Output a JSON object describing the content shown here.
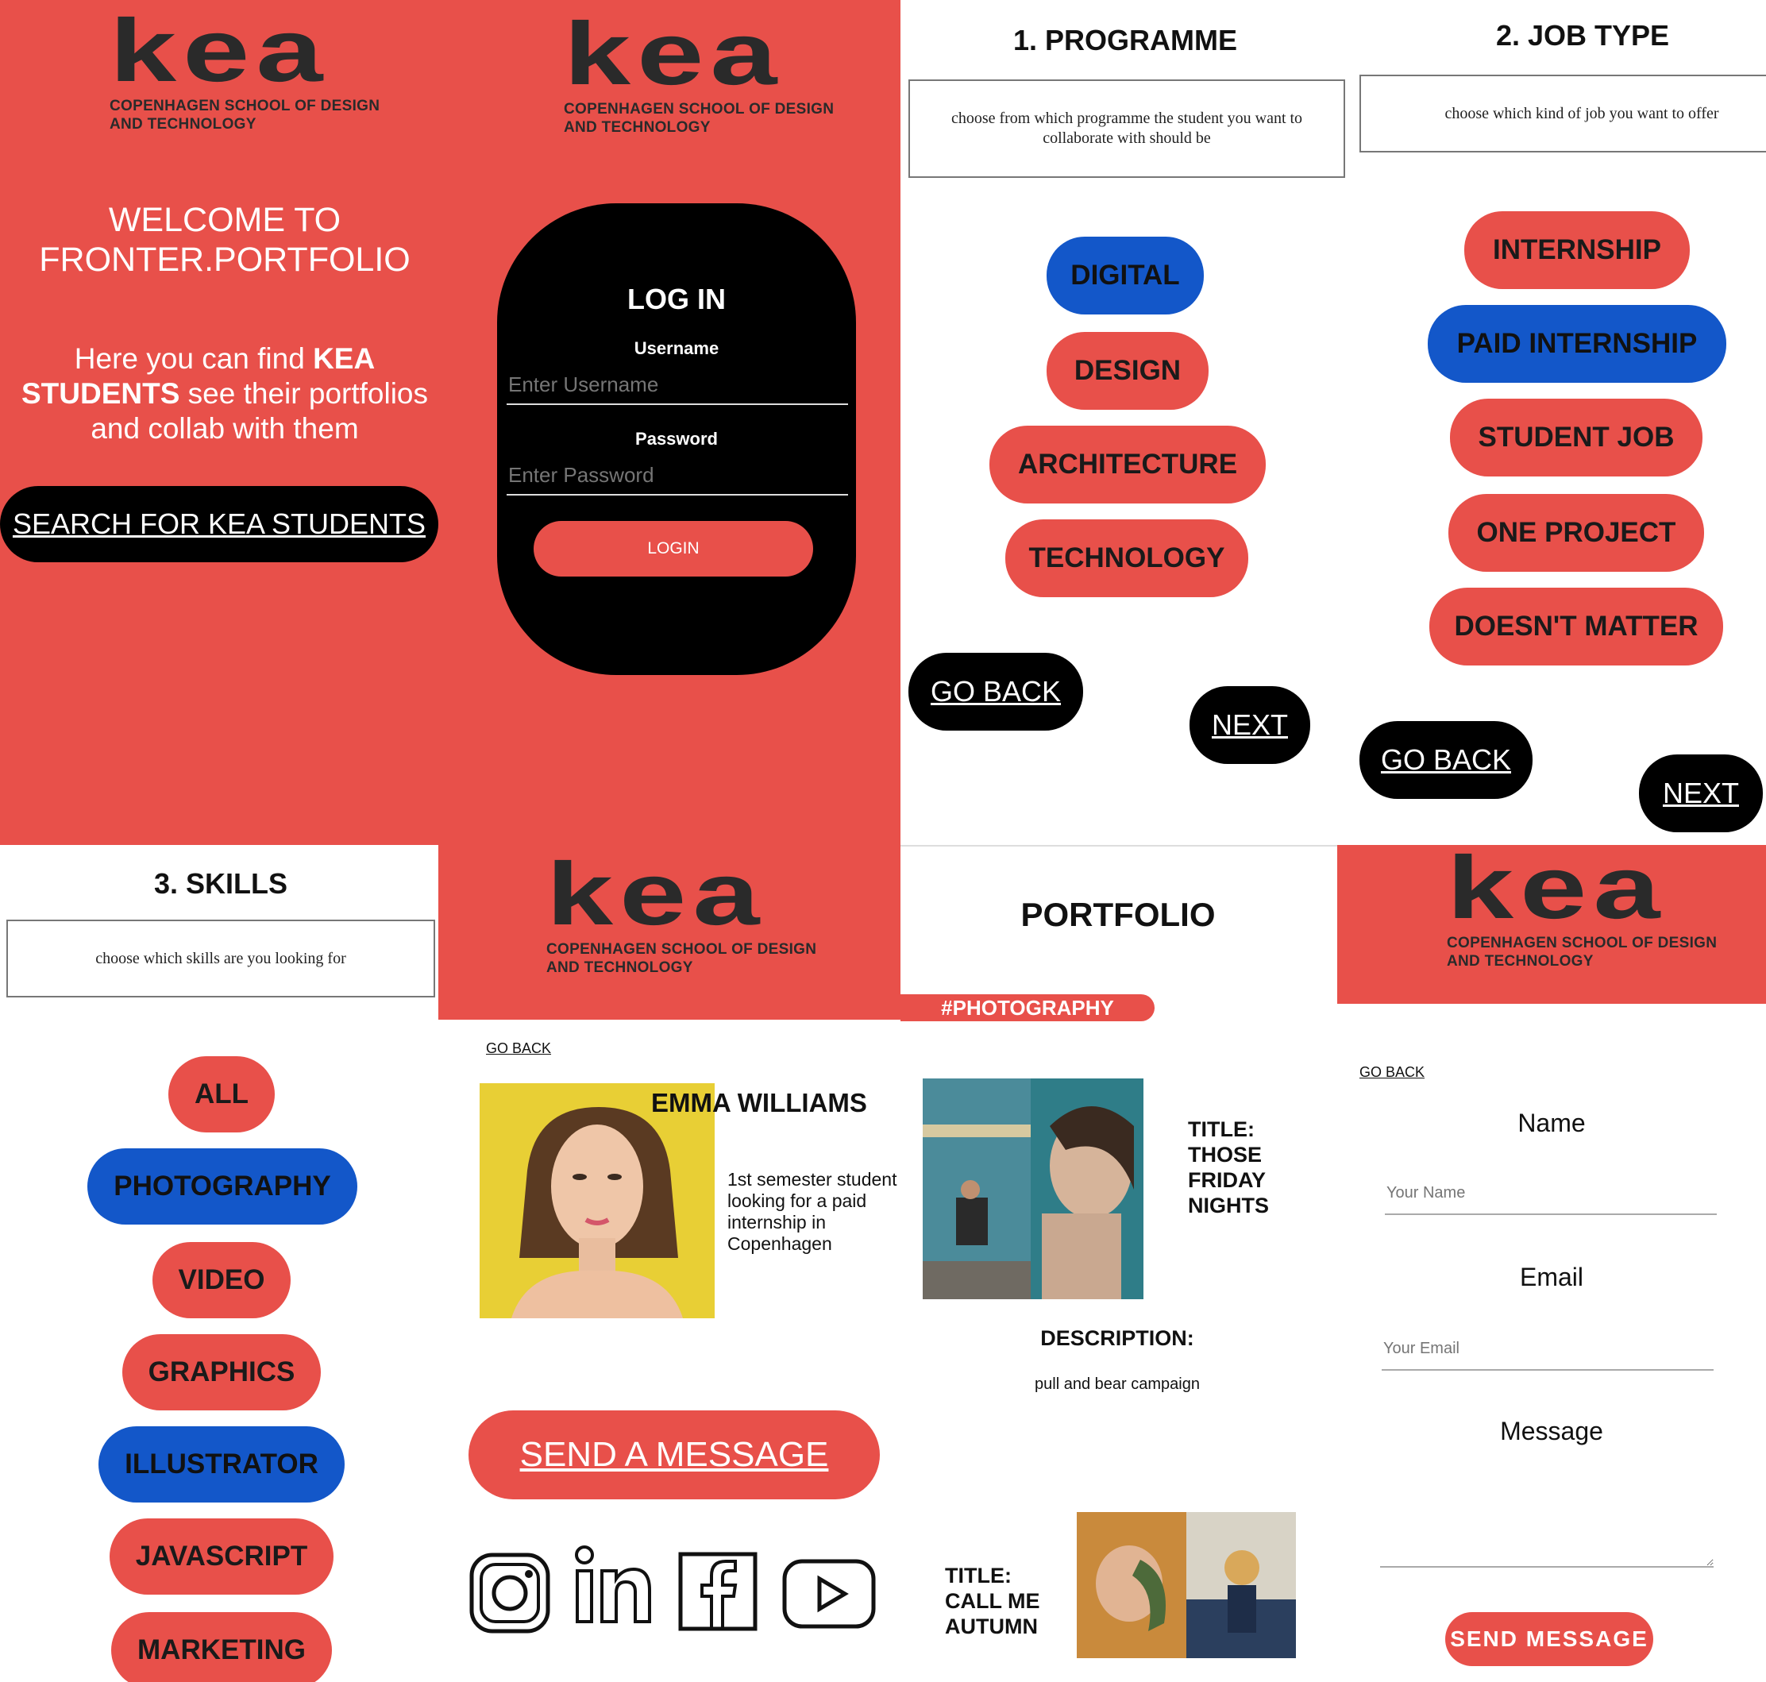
{
  "logo": {
    "word": "kea",
    "line1": "COPENHAGEN SCHOOL OF DESIGN",
    "line2": "AND TECHNOLOGY"
  },
  "welcome": {
    "title_line1": "WELCOME TO",
    "title_line2": "FRONTER.PORTFOLIO",
    "intro_pre": "Here you can find ",
    "intro_bold1": "KEA",
    "intro_bold2": "STUDENTS",
    "intro_post1": " see their portfolios",
    "intro_post2": "and collab with them",
    "search_button": "SEARCH FOR KEA STUDENTS"
  },
  "login": {
    "title": "LOG IN",
    "username_label": "Username",
    "username_placeholder": "Enter Username",
    "password_label": "Password",
    "password_placeholder": "Enter Password",
    "login_button": "LOGIN"
  },
  "programme": {
    "title": "1. PROGRAMME",
    "instruction": "choose from which programme the student you want to collaborate with should be",
    "options": [
      "DIGITAL",
      "DESIGN",
      "ARCHITECTURE",
      "TECHNOLOGY"
    ],
    "selected": "DIGITAL",
    "back": "GO BACK",
    "next": "NEXT"
  },
  "job_type": {
    "title": "2. JOB TYPE",
    "instruction": "choose which kind of job you want to offer",
    "options": [
      "INTERNSHIP",
      "PAID INTERNSHIP",
      "STUDENT JOB",
      "ONE PROJECT",
      "DOESN'T MATTER"
    ],
    "selected": "PAID INTERNSHIP",
    "back": "GO BACK",
    "next": "NEXT"
  },
  "skills": {
    "title": "3. SKILLS",
    "instruction": "choose which skills are you looking for",
    "options": [
      "ALL",
      "PHOTOGRAPHY",
      "VIDEO",
      "GRAPHICS",
      "ILLUSTRATOR",
      "JAVASCRIPT",
      "MARKETING"
    ],
    "selected": [
      "PHOTOGRAPHY",
      "ILLUSTRATOR"
    ]
  },
  "profile": {
    "back": "GO BACK",
    "name": "EMMA WILLIAMS",
    "bio_line1": "1st semester student",
    "bio_line2": "looking for a paid",
    "bio_line3": "internship in",
    "bio_line4": "Copenhagen",
    "send_button": "SEND A MESSAGE",
    "social_icons": [
      "instagram-icon",
      "linkedin-icon",
      "facebook-icon",
      "youtube-icon"
    ]
  },
  "portfolio": {
    "title": "PORTFOLIO",
    "tag": "#PHOTOGRAPHY",
    "item1_title1": "TITLE:",
    "item1_title2": "THOSE",
    "item1_title3": "FRIDAY",
    "item1_title4": "NIGHTS",
    "description_label": "DESCRIPTION:",
    "description": "pull and bear campaign",
    "item2_title1": "TITLE:",
    "item2_title2": "CALL ME",
    "item2_title3": "AUTUMN"
  },
  "contact": {
    "back": "GO BACK",
    "name_label": "Name",
    "name_placeholder": "Your Name",
    "email_label": "Email",
    "email_placeholder": "Your Email",
    "message_label": "Message",
    "send_button": "SEND MESSAGE"
  },
  "colors": {
    "brand_red": "#e8504a",
    "selected_blue": "#1357c9",
    "black": "#000000"
  }
}
